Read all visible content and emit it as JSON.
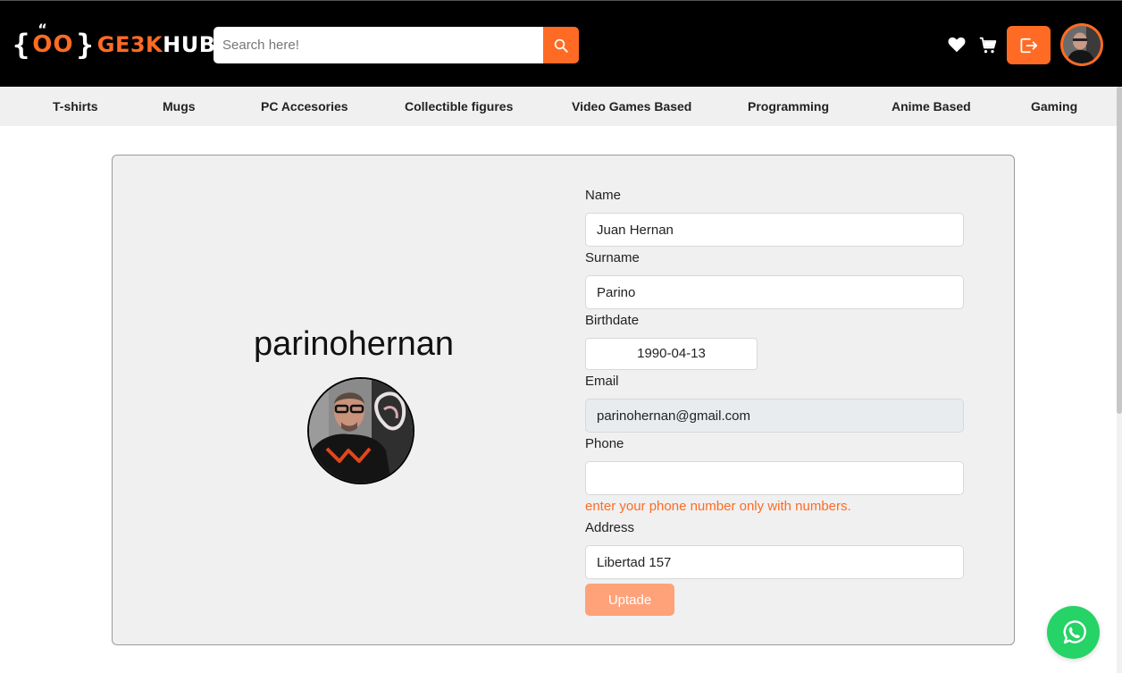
{
  "header": {
    "logo": {
      "eyes": "OO",
      "quote": "“",
      "brand_prefix": "GE3K",
      "brand_suffix": "HUB"
    },
    "search": {
      "placeholder": "Search here!",
      "value": ""
    },
    "icons": {
      "search": "search-icon",
      "favorites": "heart-icon",
      "cart": "cart-icon",
      "logout": "logout-icon"
    }
  },
  "categories": [
    "T-shirts",
    "Mugs",
    "PC Accesories",
    "Collectible figures",
    "Video Games Based",
    "Programming",
    "Anime Based",
    "Gaming"
  ],
  "profile": {
    "username": "parinohernan",
    "form": {
      "name_label": "Name",
      "name_value": "Juan Hernan",
      "surname_label": "Surname",
      "surname_value": "Parino",
      "birthdate_label": "Birthdate",
      "birthdate_value": "1990-04-13",
      "email_label": "Email",
      "email_value": "parinohernan@gmail.com",
      "phone_label": "Phone",
      "phone_value": "",
      "phone_hint": "enter your phone number only with numbers.",
      "address_label": "Address",
      "address_value": "Libertad 157",
      "submit_label": "Uptade"
    }
  },
  "colors": {
    "accent": "#ff6b24",
    "header_bg": "#000000",
    "nav_bg": "#f0f0f0",
    "card_bg": "#f0f0f0",
    "button_disabled": "#ffa27a",
    "whatsapp": "#25d366"
  }
}
